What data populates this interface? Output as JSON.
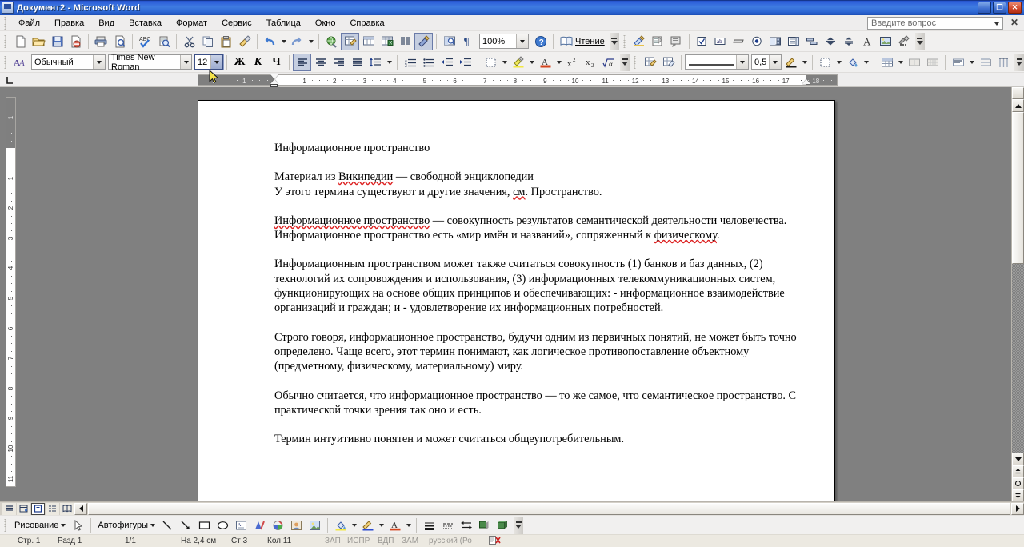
{
  "window": {
    "title": "Документ2 - Microsoft Word",
    "minimize": "_",
    "maximize": "❐",
    "close": "✕"
  },
  "menubar": {
    "items": [
      {
        "label": "Файл"
      },
      {
        "label": "Правка"
      },
      {
        "label": "Вид"
      },
      {
        "label": "Вставка"
      },
      {
        "label": "Формат"
      },
      {
        "label": "Сервис"
      },
      {
        "label": "Таблица"
      },
      {
        "label": "Окно"
      },
      {
        "label": "Справка"
      }
    ],
    "ask_placeholder": "Введите вопрос",
    "ask_close": "✕"
  },
  "standard_toolbar": {
    "zoom_value": "100%",
    "reading_label": "Чтение",
    "buttons": [
      "new-document",
      "open",
      "save",
      "permission",
      "print",
      "print-preview",
      "spelling",
      "research",
      "cut",
      "copy",
      "paste",
      "format-painter",
      "undo",
      "redo",
      "insert-hyperlink",
      "tables-and-borders",
      "insert-table",
      "insert-excel-spreadsheet",
      "columns",
      "drawing",
      "document-map",
      "show-formatting-marks",
      "zoom",
      "help"
    ]
  },
  "controls_toolbar": {
    "buttons": [
      "design-mode",
      "properties",
      "view-code",
      "checkbox-control",
      "textbox-control",
      "command-button",
      "option-button",
      "combobox-control",
      "listbox-control",
      "toggle-button",
      "spin-button",
      "scrollbar-control",
      "label-control",
      "image-control",
      "more-controls"
    ]
  },
  "formatting_toolbar": {
    "style_value": "Обычный",
    "font_value": "Times New Roman",
    "size_value": "12",
    "bold_label": "Ж",
    "italic_label": "К",
    "underline_label": "Ч",
    "line_weight": "0,5",
    "buttons": [
      "styles-and-formatting",
      "align-left",
      "align-center",
      "align-right",
      "justify",
      "line-spacing",
      "numbering",
      "bullets",
      "decrease-indent",
      "increase-indent",
      "outside-border",
      "highlight",
      "font-color",
      "superscript",
      "subscript",
      "equation"
    ]
  },
  "tables_toolbar": {
    "buttons": [
      "draw-table",
      "eraser",
      "line-style",
      "line-weight",
      "border-color",
      "borders",
      "shading-color",
      "insert-table",
      "merge-cells",
      "split-cells",
      "align-top-left",
      "distribute-rows",
      "distribute-columns"
    ]
  },
  "ruler": {
    "horizontal_ticks": [
      "2",
      "1",
      "1",
      "2",
      "3",
      "4",
      "5",
      "6",
      "7",
      "8",
      "9",
      "10",
      "11",
      "12",
      "13",
      "14",
      "15",
      "16",
      "17",
      "18"
    ],
    "vertical_ticks": [
      "1",
      "1",
      "2",
      "3",
      "4",
      "5",
      "6",
      "7",
      "8",
      "9",
      "10",
      "11"
    ]
  },
  "document": {
    "heading": "Информационное пространство",
    "paragraphs": [
      {
        "lines": [
          "Материал из Википедии — свободной энциклопедии",
          "У этого термина существуют и другие значения, см. Пространство."
        ]
      },
      {
        "lines": [
          "Информационное пространство — совокупность результатов семантической деятельности",
          "человечества. Информационное пространство есть «мир имён и названий», сопряженный к",
          "физическому."
        ]
      },
      {
        "lines": [
          "Информационным пространством может также считаться совокупность (1) банков и баз",
          "данных, (2) технологий их сопровождения и использования, (3) информационных",
          "телекоммуникационных систем, функционирующих на основе общих принципов и",
          "обеспечивающих: - информационное взаимодействие организаций и граждан; и -",
          "удовлетворение их информационных потребностей."
        ]
      },
      {
        "lines": [
          "Строго говоря, информационное пространство, будучи одним из первичных понятий, не может",
          "быть точно определено. Чаще всего, этот термин понимают, как логическое",
          "противопоставление объектному (предметному, физическому, материальному) миру."
        ]
      },
      {
        "lines": [
          "Обычно считается, что информационное пространство — то же самое, что семантическое",
          "пространство. С практической точки зрения так оно и есть."
        ]
      },
      {
        "lines": [
          "Термин интуитивно понятен и может считаться общеупотребительным."
        ]
      }
    ]
  },
  "view_buttons": {
    "items": [
      "normal-view",
      "web-layout-view",
      "print-layout-view",
      "outline-view",
      "reading-layout-view"
    ],
    "active_index": 2
  },
  "drawing_toolbar": {
    "draw_label": "Рисование",
    "autoshapes_label": "Автофигуры",
    "buttons": [
      "select-objects",
      "line",
      "arrow",
      "rectangle",
      "oval",
      "text-box",
      "wordart",
      "diagram",
      "clip-art",
      "picture",
      "fill-color",
      "line-color",
      "font-color",
      "line-style",
      "dash-style",
      "arrow-style",
      "shadow-style",
      "3d-style"
    ]
  },
  "statusbar": {
    "page": "Стр. 1",
    "section": "Разд 1",
    "pages": "1/1",
    "position": "На 2,4 см",
    "line": "Ст 3",
    "column": "Кол 11",
    "rec": "ЗАП",
    "trk": "ИСПР",
    "ext": "ВДП",
    "ovr": "ЗАМ",
    "language": "русский (Ро",
    "spell_icon": "spelling-status-icon"
  },
  "colors": {
    "title_start": "#0a246a",
    "title_end": "#1c4fb8",
    "toolbar_bg": "#f1f0ef",
    "desktop": "#808080",
    "page_bg": "#ffffff",
    "spellcheck": "#dd2222",
    "accent": "#6a7ba8"
  }
}
